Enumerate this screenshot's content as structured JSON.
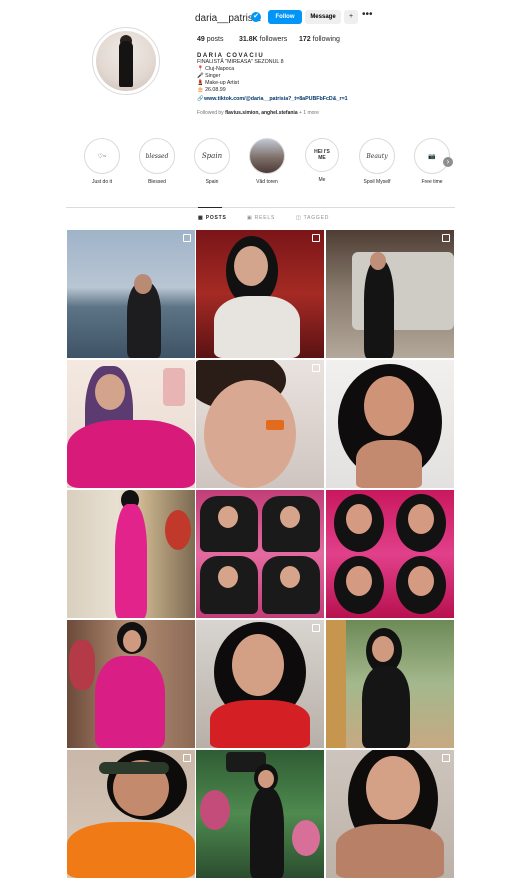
{
  "header": {
    "username": "daria__patrisia",
    "verified_mark": "✔",
    "follow_label": "Follow",
    "message_label": "Message",
    "add_user_icon": "+",
    "more_label": "•••"
  },
  "stats": {
    "posts_count": "49",
    "posts_label": "posts",
    "followers_count": "31.8K",
    "followers_label": "followers",
    "following_count": "172",
    "following_label": "following"
  },
  "bio": {
    "full_name": "DARIA COVACIU",
    "line1": "FINALISTĂ \"MIREASA\" SEZONUL 8",
    "line2": "📍 Cluj-Napoca",
    "line3": "🎤 Singer",
    "line4": "💄 Make-up Artist",
    "line5": "🎂 26.08.99",
    "link_icon": "🔗",
    "link": "www.tiktok.com/@daria__patrisia?_t=8aPUBFbFcD&_r=1",
    "followed_prefix": "Followed by ",
    "followed_names": "flavius.simion, anghel.stefania",
    "followed_suffix": " + 1 more"
  },
  "highlights": [
    {
      "label": "Just do it",
      "cover": "♡~"
    },
    {
      "label": "Blessed",
      "cover": "blessed"
    },
    {
      "label": "Spain",
      "cover": "Spain"
    },
    {
      "label": "Văd toren",
      "cover": ""
    },
    {
      "label": "Me",
      "cover": "HEI I'S ME"
    },
    {
      "label": "Spoil Myself",
      "cover": "Beauty"
    },
    {
      "label": "Free time",
      "cover": "📷"
    }
  ],
  "highlights_next_icon": "›",
  "tabs": {
    "posts": "POSTS",
    "reels": "REELS",
    "tagged": "TAGGED"
  },
  "colors": {
    "accent": "#0095f6",
    "link": "#00376b",
    "divider": "#dbdbdb"
  }
}
